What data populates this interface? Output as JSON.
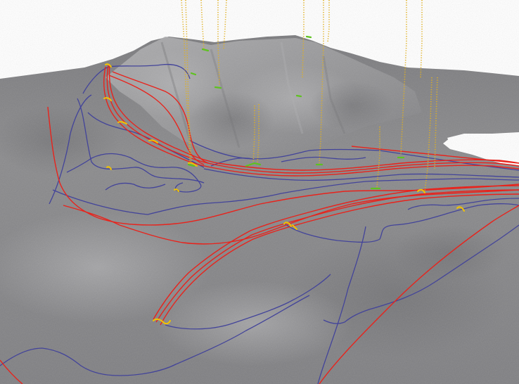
{
  "scene": {
    "view": "3d-terrain-perspective",
    "colors": {
      "sky": "#ffffff",
      "terrain_light": "#a3a3a5",
      "terrain_mid": "#8d8d8f",
      "terrain_dark": "#6f6f72",
      "red_route": "#e8231c",
      "blue_route": "#43449a",
      "yellow_marker": "#f2c200",
      "green_marker": "#5ec21f",
      "vertical_points": "#e0b020"
    },
    "layers": [
      {
        "name": "terrain-surface",
        "kind": "elevation-mesh"
      },
      {
        "name": "red-routes",
        "kind": "polyline-set",
        "count": 12
      },
      {
        "name": "blue-routes",
        "kind": "polyline-set",
        "count": 10
      },
      {
        "name": "vertical-point-columns",
        "kind": "point-columns",
        "count": 12
      },
      {
        "name": "yellow-markers",
        "kind": "marker-clusters",
        "count": 12
      },
      {
        "name": "green-markers",
        "kind": "marker-clusters",
        "count": 10
      }
    ]
  }
}
